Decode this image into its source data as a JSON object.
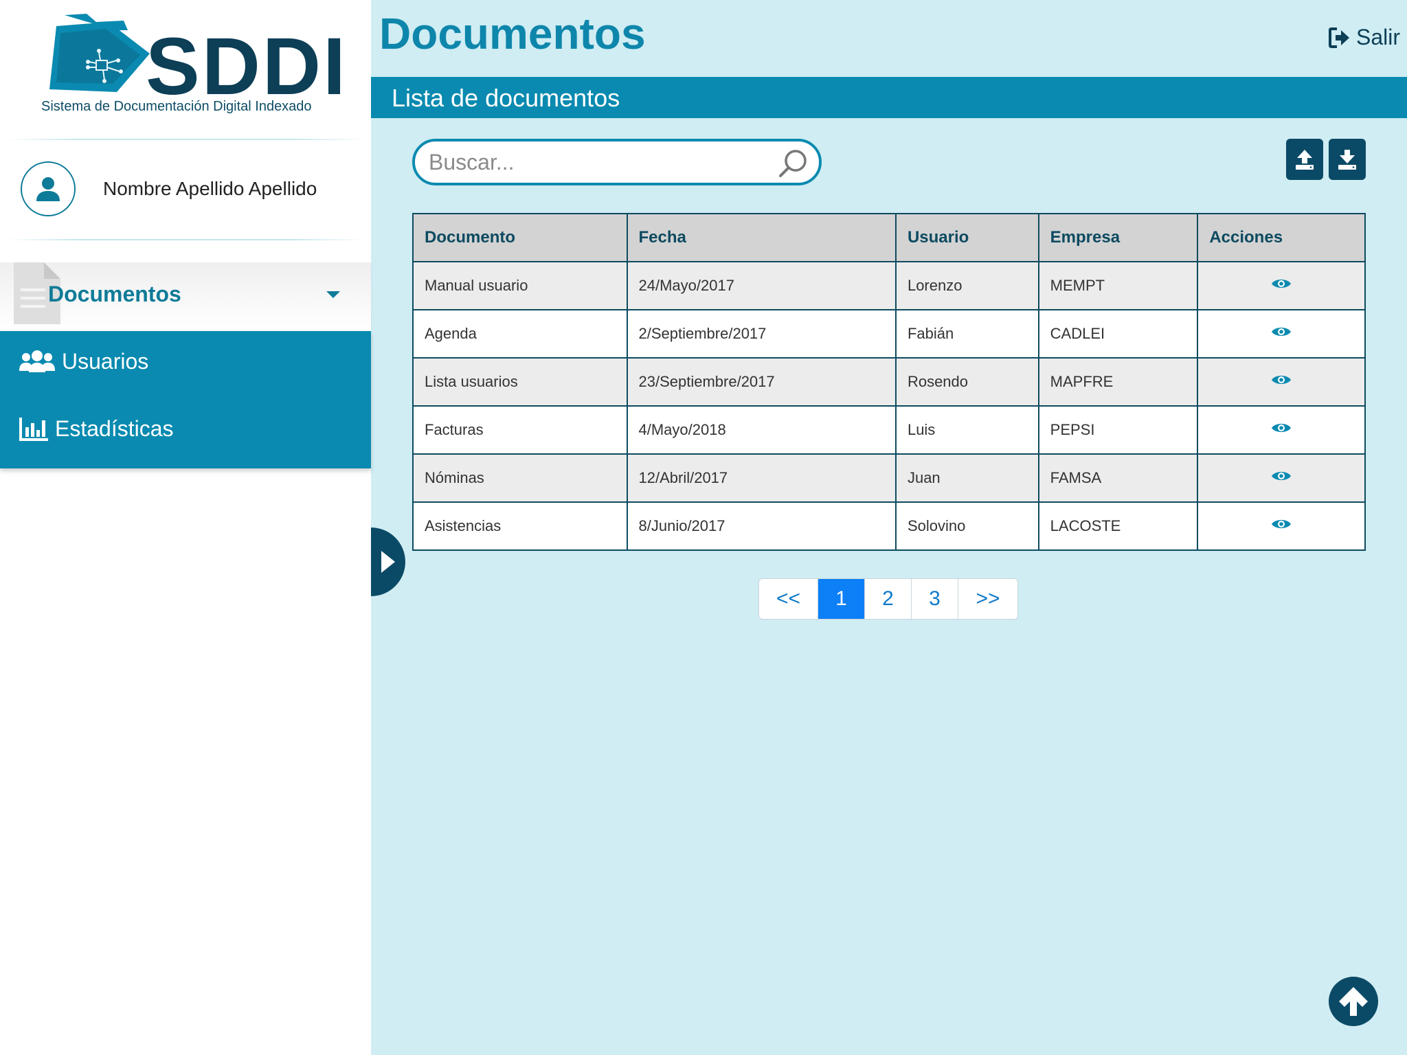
{
  "brand": {
    "name": "SDDI",
    "subtitle": "Sistema de Documentación Digital Indexado"
  },
  "user": {
    "name": "Nombre Apellido Apellido"
  },
  "sidebar": {
    "items": [
      {
        "label": "Documentos",
        "icon": "document-icon",
        "active": true
      },
      {
        "label": "Usuarios",
        "icon": "users-icon"
      },
      {
        "label": "Estadísticas",
        "icon": "bar-chart-icon"
      }
    ]
  },
  "header": {
    "title": "Documentos",
    "logout_label": "Salir"
  },
  "section": {
    "title": "Lista de documentos"
  },
  "search": {
    "placeholder": "Buscar..."
  },
  "table": {
    "columns": [
      "Documento",
      "Fecha",
      "Usuario",
      "Empresa",
      "Acciones"
    ],
    "rows": [
      [
        "Manual usuario",
        "24/Mayo/2017",
        "Lorenzo",
        "MEMPT"
      ],
      [
        "Agenda",
        "2/Septiembre/2017",
        "Fabián",
        "CADLEI"
      ],
      [
        "Lista usuarios",
        "23/Septiembre/2017",
        "Rosendo",
        "MAPFRE"
      ],
      [
        "Facturas",
        "4/Mayo/2018",
        "Luis",
        "PEPSI"
      ],
      [
        "Nóminas",
        "12/Abril/2017",
        "Juan",
        "FAMSA"
      ],
      [
        "Asistencias",
        "8/Junio/2017",
        "Solovino",
        "LACOSTE"
      ]
    ],
    "action_icon": "eye-icon"
  },
  "pagination": {
    "prev": "<<",
    "pages": [
      "1",
      "2",
      "3"
    ],
    "current": "1",
    "next": ">>"
  },
  "colors": {
    "primary": "#0a8ab0",
    "dark": "#0b4a66",
    "background": "#cfedf3",
    "page_active": "#0d7ff7"
  }
}
